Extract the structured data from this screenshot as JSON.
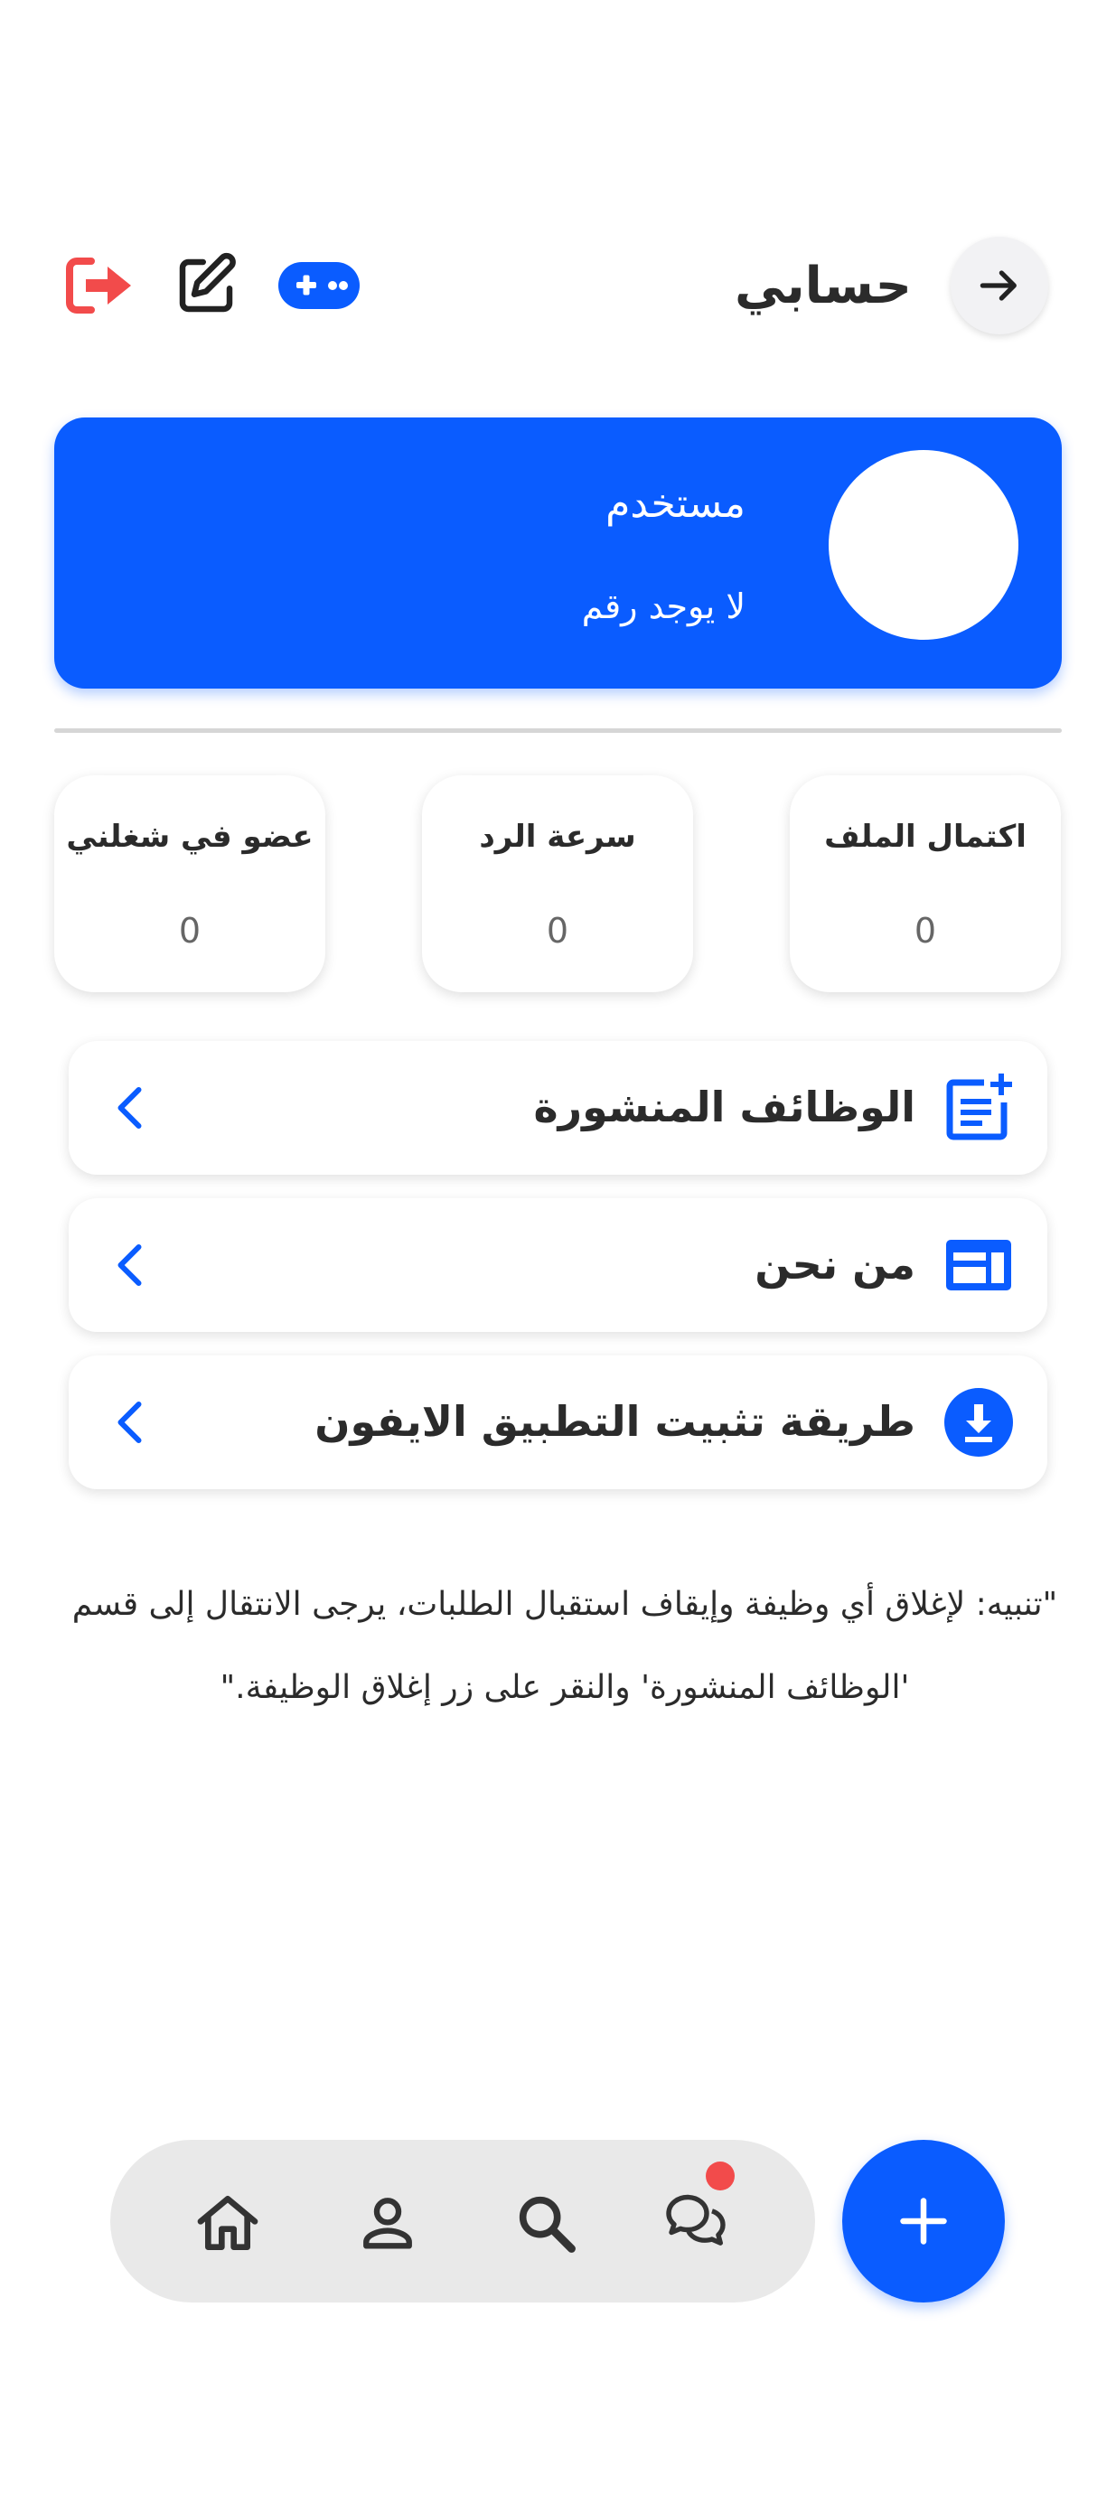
{
  "header": {
    "title": "حسابي",
    "back_icon": "arrow-right-icon",
    "actions": [
      {
        "icon": "gamepad-icon",
        "color": "#0a5cff"
      },
      {
        "icon": "edit-icon",
        "color": "#222222"
      },
      {
        "icon": "logout-icon",
        "color": "#f24b4b"
      }
    ]
  },
  "profile": {
    "name": "مستخدم",
    "phone": "لا يوجد رقم",
    "card_color": "#0a5cff"
  },
  "stats": [
    {
      "label": "اكتمال الملف",
      "value": "0"
    },
    {
      "label": "سرعة الرد",
      "value": "0"
    },
    {
      "label": "عضو في شغلني",
      "value": "0"
    }
  ],
  "menu": [
    {
      "label": "الوظائف المنشورة",
      "icon": "post-add-icon"
    },
    {
      "label": "من نحن",
      "icon": "info-panel-icon"
    },
    {
      "label": "طريقة تثبيت التطبيق الايفون",
      "icon": "download-icon"
    }
  ],
  "notice": "\"تنبيه: لإغلاق أي وظيفة وإيقاف استقبال الطلبات، يرجى الانتقال إلى قسم 'الوظائف المنشورة' والنقر على زر إغلاق الوظيفة.\"",
  "bottom_nav": {
    "items": [
      "home-icon",
      "profile-icon",
      "search-icon",
      "chat-icon"
    ],
    "chat_badge_color": "#f24b4b",
    "fab_icon": "plus-icon"
  },
  "colors": {
    "accent": "#0a5cff",
    "danger": "#f24b4b",
    "nav_bg": "#e9e9e9"
  }
}
